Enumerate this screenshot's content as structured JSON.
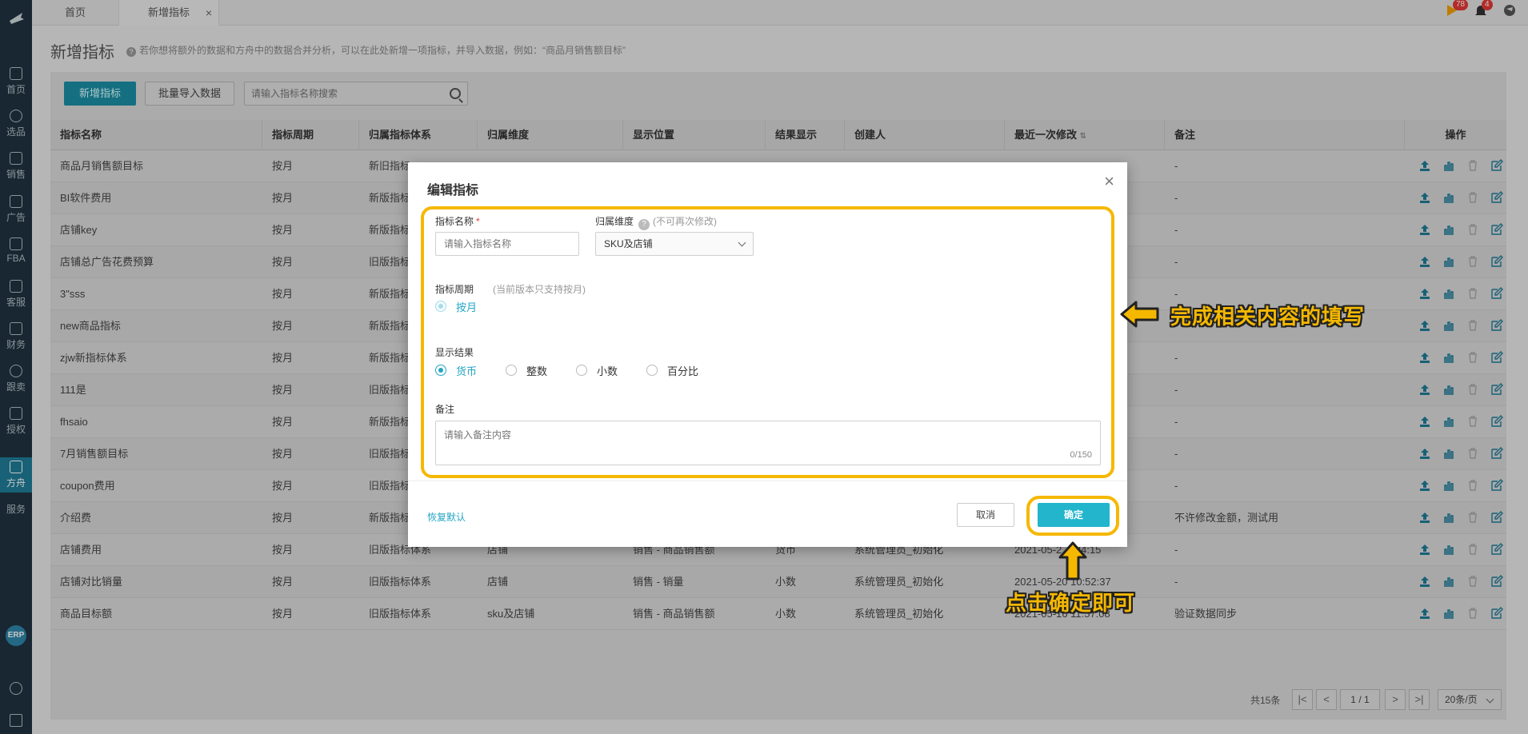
{
  "tabs": [
    {
      "label": "首页"
    },
    {
      "label": "新增指标"
    }
  ],
  "tab_close": "×",
  "notifications": {
    "flag_count": "78",
    "bell_count": "4"
  },
  "sidebar": {
    "items": [
      {
        "label": "首页",
        "icon": "home-icon"
      },
      {
        "label": "选品",
        "icon": "search-icon"
      },
      {
        "label": "销售",
        "icon": "chart-line-icon"
      },
      {
        "label": "广告",
        "icon": "ad-icon"
      },
      {
        "label": "FBA",
        "icon": "box-icon"
      },
      {
        "label": "客服",
        "icon": "service-icon"
      },
      {
        "label": "财务",
        "icon": "dollar-icon"
      },
      {
        "label": "跟卖",
        "icon": "pie-icon"
      },
      {
        "label": "授权",
        "icon": "shield-icon"
      },
      {
        "label": "方舟",
        "icon": "ark-icon"
      },
      {
        "label": "服务",
        "icon": "service2-icon"
      }
    ],
    "erp": "ERP"
  },
  "page": {
    "title": "新增指标",
    "hint": "若你想将额外的数据和方舟中的数据合并分析，可以在此处新增一项指标，并导入数据，例如：“商品月销售额目标”"
  },
  "toolbar": {
    "add_label": "新增指标",
    "import_label": "批量导入数据",
    "search_placeholder": "请输入指标名称搜索"
  },
  "table": {
    "headers": [
      "指标名称",
      "指标周期",
      "归属指标体系",
      "归属维度",
      "显示位置",
      "结果显示",
      "创建人",
      "最近一次修改",
      "备注",
      "操作"
    ],
    "rows": [
      {
        "name": "商品月销售额目标",
        "period": "按月",
        "system": "新旧指标…",
        "dim": "",
        "pos": "",
        "result": "",
        "creator": "",
        "modified": "",
        "note": "-"
      },
      {
        "name": "BI软件费用",
        "period": "按月",
        "system": "新版指标",
        "dim": "",
        "pos": "",
        "result": "",
        "creator": "",
        "modified": "",
        "note": "-"
      },
      {
        "name": "店铺key",
        "period": "按月",
        "system": "新版指标",
        "dim": "",
        "pos": "",
        "result": "",
        "creator": "",
        "modified": "",
        "note": "-"
      },
      {
        "name": "店铺总广告花费预算",
        "period": "按月",
        "system": "旧版指标",
        "dim": "",
        "pos": "",
        "result": "",
        "creator": "",
        "modified": "",
        "note": "-"
      },
      {
        "name": "3\"sss",
        "period": "按月",
        "system": "新版指标",
        "dim": "",
        "pos": "",
        "result": "",
        "creator": "",
        "modified": "",
        "note": "-"
      },
      {
        "name": "new商品指标",
        "period": "按月",
        "system": "新版指标",
        "dim": "",
        "pos": "",
        "result": "",
        "creator": "",
        "modified": "",
        "note": ""
      },
      {
        "name": "zjw新指标体系",
        "period": "按月",
        "system": "新版指标",
        "dim": "",
        "pos": "",
        "result": "",
        "creator": "",
        "modified": "",
        "note": "-"
      },
      {
        "name": "111是",
        "period": "按月",
        "system": "旧版指标",
        "dim": "",
        "pos": "",
        "result": "",
        "creator": "",
        "modified": "",
        "note": "-"
      },
      {
        "name": "fhsaio",
        "period": "按月",
        "system": "新版指标",
        "dim": "",
        "pos": "",
        "result": "",
        "creator": "",
        "modified": "",
        "note": "-"
      },
      {
        "name": "7月销售额目标",
        "period": "按月",
        "system": "旧版指标",
        "dim": "",
        "pos": "",
        "result": "",
        "creator": "",
        "modified": "",
        "note": "-"
      },
      {
        "name": "coupon费用",
        "period": "按月",
        "system": "旧版指标",
        "dim": "",
        "pos": "",
        "result": "",
        "creator": "",
        "modified": "",
        "note": "-"
      },
      {
        "name": "介绍费",
        "period": "按月",
        "system": "新版指标",
        "dim": "",
        "pos": "",
        "result": "",
        "creator": "",
        "modified": "",
        "note": "不许修改金额，测试用"
      },
      {
        "name": "店铺费用",
        "period": "按月",
        "system": "旧版指标体系",
        "dim": "店铺",
        "pos": "销售 - 商品销售额",
        "result": "货币",
        "creator": "系统管理员_初始化",
        "modified": "2021-05-2…:24:15",
        "note": "-"
      },
      {
        "name": "店铺对比销量",
        "period": "按月",
        "system": "旧版指标体系",
        "dim": "店铺",
        "pos": "销售 - 销量",
        "result": "小数",
        "creator": "系统管理员_初始化",
        "modified": "2021-05-20 10:52:37",
        "note": "-"
      },
      {
        "name": "商品目标额",
        "period": "按月",
        "system": "旧版指标体系",
        "dim": "sku及店铺",
        "pos": "销售 - 商品销售额",
        "result": "小数",
        "creator": "系统管理员_初始化",
        "modified": "2021-05-16 11:57:08",
        "note": "验证数据同步"
      }
    ]
  },
  "pagination": {
    "total": "共15条",
    "current": "1",
    "sep": "/",
    "pages": "1",
    "page_size": "20条/页",
    "first": "|<",
    "prev": "<",
    "next": ">",
    "last": ">|"
  },
  "modal": {
    "title": "编辑指标",
    "close": "×",
    "name_label": "指标名称",
    "required_mark": "*",
    "name_placeholder": "请输入指标名称",
    "dim_label": "归属维度",
    "dim_hint": "(不可再次修改)",
    "dim_value": "SKU及店铺",
    "period_label": "指标周期",
    "period_hint": "(当前版本只支持按月)",
    "period_option": "按月",
    "result_label": "显示结果",
    "result_options": [
      "货币",
      "整数",
      "小数",
      "百分比"
    ],
    "result_selected": "货币",
    "note_label": "备注",
    "note_placeholder": "请输入备注内容",
    "note_counter": "0/150",
    "reset_label": "恢复默认",
    "cancel_label": "取消",
    "ok_label": "确定"
  },
  "annotations": {
    "fill_text": "完成相关内容的填写",
    "ok_text": "点击确定即可",
    "color": "#f5b800"
  },
  "colors": {
    "accent": "#22a5c4",
    "sidebar_bg": "#1f3340",
    "primary_button": "#22b5cc"
  }
}
